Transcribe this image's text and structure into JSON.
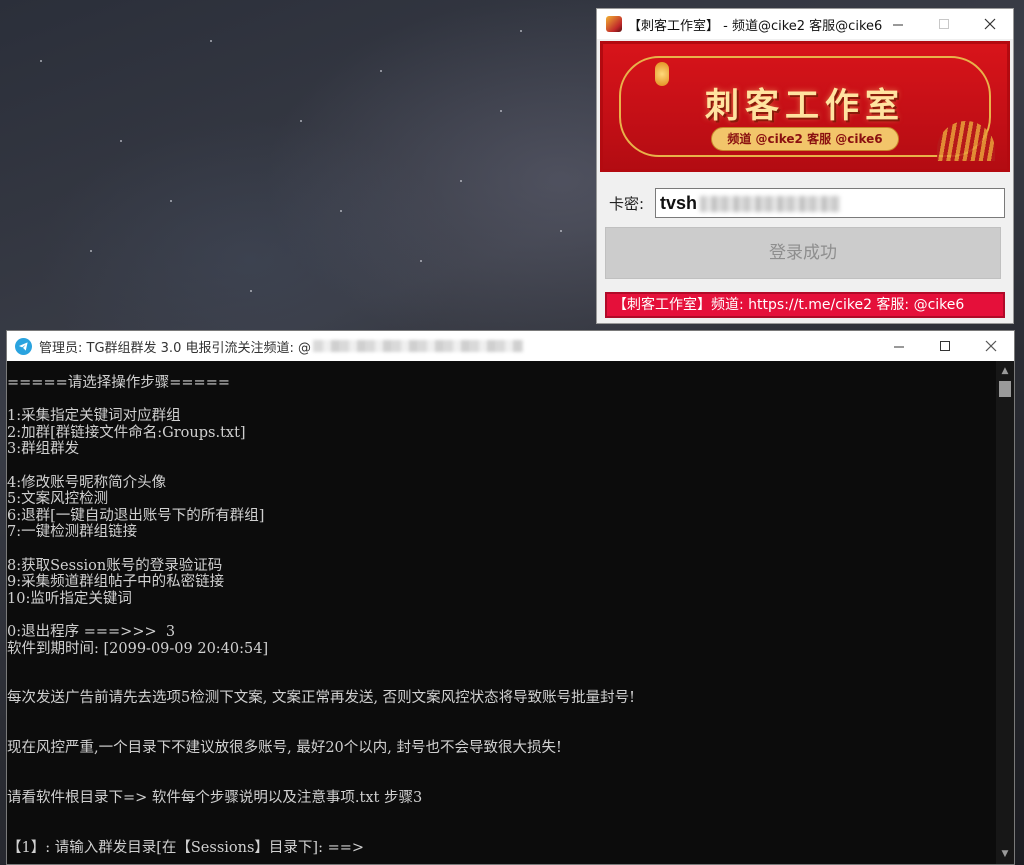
{
  "login_window": {
    "title": "【刺客工作室】 - 频道@cike2 客服@cike6",
    "banner": {
      "title": "刺客工作室",
      "subtitle": "频道 @cike2 客服 @cike6"
    },
    "key_label": "卡密:",
    "key_value": "tvsh",
    "login_button": "登录成功",
    "footer": "【刺客工作室】频道: https://t.me/cike2 客服: @cike6",
    "footer_color": "#e5103a"
  },
  "console_window": {
    "title": "管理员: TG群组群发 3.0  电报引流关注频道: @",
    "lines": [
      "=====请选择操作步骤=====",
      "",
      "1:采集指定关键词对应群组",
      "2:加群[群链接文件命名:Groups.txt]",
      "3:群组群发",
      "",
      "4:修改账号昵称简介头像",
      "5:文案风控检测",
      "6:退群[一键自动退出账号下的所有群组]",
      "7:一键检测群组链接",
      "",
      "8:获取Session账号的登录验证码",
      "9:采集频道群组帖子中的私密链接",
      "10:监听指定关键词",
      "",
      "0:退出程序 ===>>>  3",
      "软件到期时间: [2099-09-09 20:40:54]",
      "",
      "",
      "每次发送广告前请先去选项5检测下文案, 文案正常再发送, 否则文案风控状态将导致账号批量封号!",
      "",
      "",
      "现在风控严重,一个目录下不建议放很多账号, 最好20个以内, 封号也不会导致很大损失!",
      "",
      "",
      "请看软件根目录下=> 软件每个步骤说明以及注意事项.txt 步骤3",
      "",
      "",
      "【1】: 请输入群发目录[在【Sessions】目录下]: ==>"
    ]
  },
  "icons": {
    "login_app": "assassin-studio-icon",
    "console_app": "telegram-icon"
  }
}
